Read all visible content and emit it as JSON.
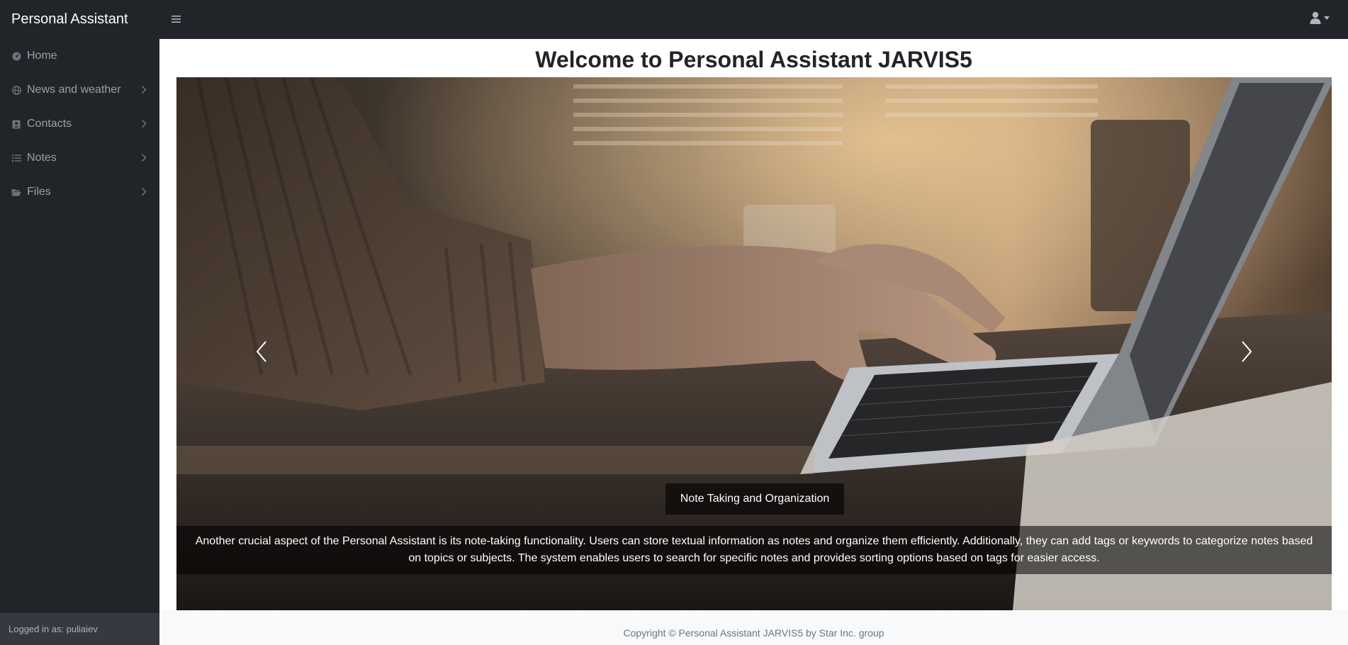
{
  "app": {
    "brand": "Personal Assistant",
    "toggle_icon": "hamburger-icon",
    "user_icon": "user-icon"
  },
  "sidebar": {
    "items": [
      {
        "label": "Home",
        "icon": "dashboard-icon",
        "has_chevron": false
      },
      {
        "label": "News and weather",
        "icon": "globe-icon",
        "has_chevron": true
      },
      {
        "label": "Contacts",
        "icon": "address-book-icon",
        "has_chevron": true
      },
      {
        "label": "Notes",
        "icon": "list-icon",
        "has_chevron": true
      },
      {
        "label": "Files",
        "icon": "folder-open-icon",
        "has_chevron": true
      }
    ],
    "footer": "Logged in as: puliaiev"
  },
  "main": {
    "title": "Welcome to Personal Assistant JARVIS5",
    "carousel": {
      "caption_title": "Note Taking and Organization",
      "caption_text": "Another crucial aspect of the Personal Assistant is its note-taking functionality. Users can store textual information as notes and organize them efficiently. Additionally, they can add tags or keywords to categorize notes based on topics or subjects. The system enables users to search for specific notes and provides sorting options based on tags for easier access."
    },
    "footer": "Copyright © Personal Assistant JARVIS5 by Star Inc. group"
  },
  "colors": {
    "navbar": "#212529",
    "sidebar": "#212529",
    "sidebar_footer": "#343a40",
    "page_bg": "#ffffff"
  }
}
